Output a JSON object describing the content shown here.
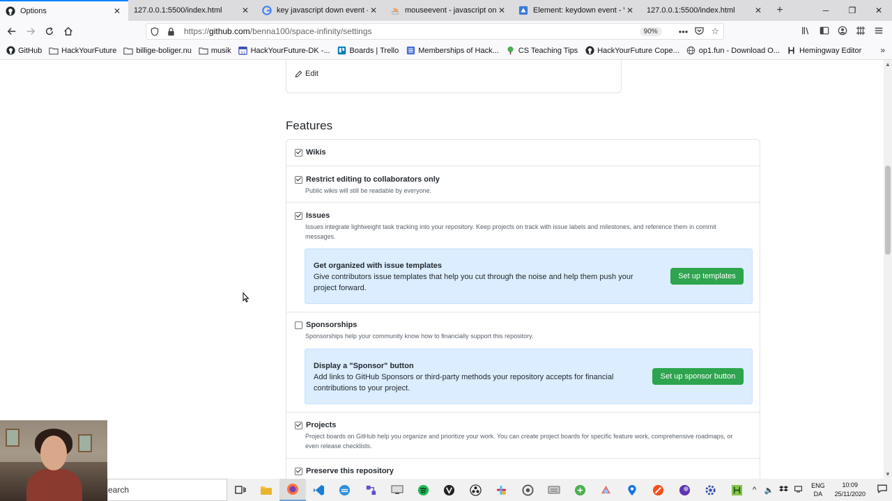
{
  "browser": {
    "tabs": [
      {
        "title": "Options",
        "favicon": "github-icon",
        "active": true
      },
      {
        "title": "127.0.0.1:5500/index.html",
        "favicon": "none",
        "active": false
      },
      {
        "title": "key javascript down event - jq",
        "favicon": "google-icon",
        "active": false
      },
      {
        "title": "mouseevent - javascript on mc",
        "favicon": "stackoverflow-icon",
        "active": false
      },
      {
        "title": "Element: keydown event - Wel",
        "favicon": "mdn-icon",
        "active": false
      },
      {
        "title": "127.0.0.1:5500/index.html",
        "favicon": "none",
        "active": false
      }
    ],
    "url_prefix": "https://",
    "url_host": "github.com",
    "url_path": "/benna100/space-infinity/settings",
    "zoom": "90%"
  },
  "bookmarks": [
    {
      "label": "GitHub",
      "icon": "github-icon"
    },
    {
      "label": "HackYourFuture",
      "icon": "folder-icon"
    },
    {
      "label": "billige-boliger.nu",
      "icon": "folder-icon"
    },
    {
      "label": "musik",
      "icon": "folder-icon"
    },
    {
      "label": "HackYourFuture-DK -...",
      "icon": "calendar-icon"
    },
    {
      "label": "Boards | Trello",
      "icon": "trello-icon"
    },
    {
      "label": "Memberships of Hack...",
      "icon": "list-icon"
    },
    {
      "label": "CS Teaching Tips",
      "icon": "tree-icon"
    },
    {
      "label": "HackYourFuture Cope...",
      "icon": "github-icon"
    },
    {
      "label": "op1.fun - Download O...",
      "icon": "globe-icon"
    },
    {
      "label": "Hemingway Editor",
      "icon": "h-icon"
    }
  ],
  "page": {
    "edit_label": "Edit",
    "features_title": "Features",
    "features": {
      "wikis": {
        "label": "Wikis",
        "checked": true
      },
      "restrict": {
        "label": "Restrict editing to collaborators only",
        "checked": true,
        "desc": "Public wikis will still be readable by everyone."
      },
      "issues": {
        "label": "Issues",
        "checked": true,
        "desc": "Issues integrate lightweight task tracking into your repository. Keep projects on track with issue labels and milestones, and reference them in commit messages."
      },
      "sponsorships": {
        "label": "Sponsorships",
        "checked": false,
        "desc": "Sponsorships help your community know how to financially support this repository."
      },
      "projects": {
        "label": "Projects",
        "checked": true,
        "desc": "Project boards on GitHub help you organize and prioritize your work. You can create project boards for specific feature work, comprehensive roadmaps, or even release checklists."
      },
      "preserve": {
        "label": "Preserve this repository",
        "checked": true
      }
    },
    "issue_templates_promo": {
      "title": "Get organized with issue templates",
      "text": "Give contributors issue templates that help you cut through the noise and help them push your project forward.",
      "button": "Set up templates"
    },
    "sponsor_promo": {
      "title": "Display a \"Sponsor\" button",
      "text": "Add links to GitHub Sponsors or third-party methods your repository accepts for financial contributions to your project.",
      "button": "Set up sponsor button"
    }
  },
  "taskbar": {
    "search_text": "earch",
    "lang_top": "ENG",
    "lang_bottom": "DA",
    "time": "10:09",
    "date": "25/11/2020"
  },
  "colors": {
    "accent_blue": "#0a84ff",
    "promo_bg": "#dbedff",
    "button_green": "#2ea44f"
  }
}
